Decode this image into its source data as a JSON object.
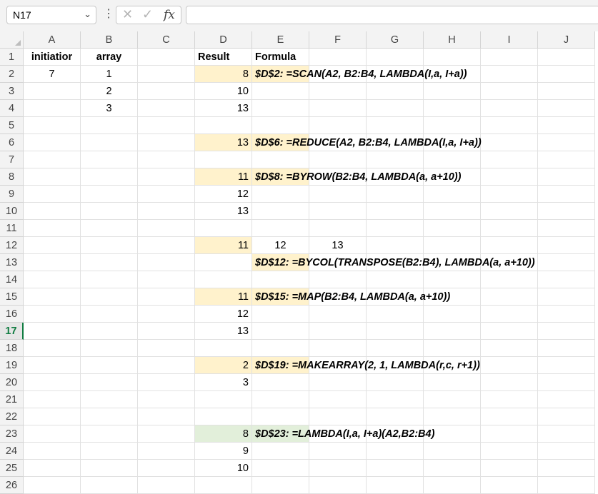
{
  "formula_bar": {
    "name_box": "N17",
    "formula": ""
  },
  "columns": [
    "A",
    "B",
    "C",
    "D",
    "E",
    "F",
    "G",
    "H",
    "I",
    "J"
  ],
  "rows": [
    "1",
    "2",
    "3",
    "4",
    "5",
    "6",
    "7",
    "8",
    "9",
    "10",
    "11",
    "12",
    "13",
    "14",
    "15",
    "16",
    "17",
    "18",
    "19",
    "20",
    "21",
    "22",
    "23",
    "24",
    "25",
    "26"
  ],
  "selected_row": "17",
  "cells": {
    "A1": "initiatior",
    "B1": "array",
    "D1": "Result",
    "E1": "Formula",
    "A2": "7",
    "B2": "1",
    "B3": "2",
    "B4": "3",
    "D2": "8",
    "D3": "10",
    "D4": "13",
    "D6": "13",
    "D8": "11",
    "D9": "12",
    "D10": "13",
    "D12": "11",
    "E12": "12",
    "F12": "13",
    "D15": "11",
    "D16": "12",
    "D17": "13",
    "D19": "2",
    "D20": "3",
    "D23": "8",
    "D24": "9",
    "D25": "10"
  },
  "formulas": {
    "E2": "$D$2: =SCAN(A2, B2:B4, LAMBDA(I,a, I+a))",
    "E6": "$D$6: =REDUCE(A2, B2:B4, LAMBDA(I,a, I+a))",
    "E8": "$D$8: =BYROW(B2:B4, LAMBDA(a, a+10))",
    "E13": "$D$12: =BYCOL(TRANSPOSE(B2:B4), LAMBDA(a, a+10))",
    "E15": "$D$15: =MAP(B2:B4, LAMBDA(a, a+10))",
    "E19": "$D$19: =MAKEARRAY(2, 1, LAMBDA(r,c, r+1))",
    "E23": "$D$23: =LAMBDA(I,a, I+a)(A2,B2:B4)"
  },
  "colors": {
    "highlight_yellow": "#fff2cc",
    "highlight_green": "#e2efda",
    "selection_green": "#107c41"
  }
}
